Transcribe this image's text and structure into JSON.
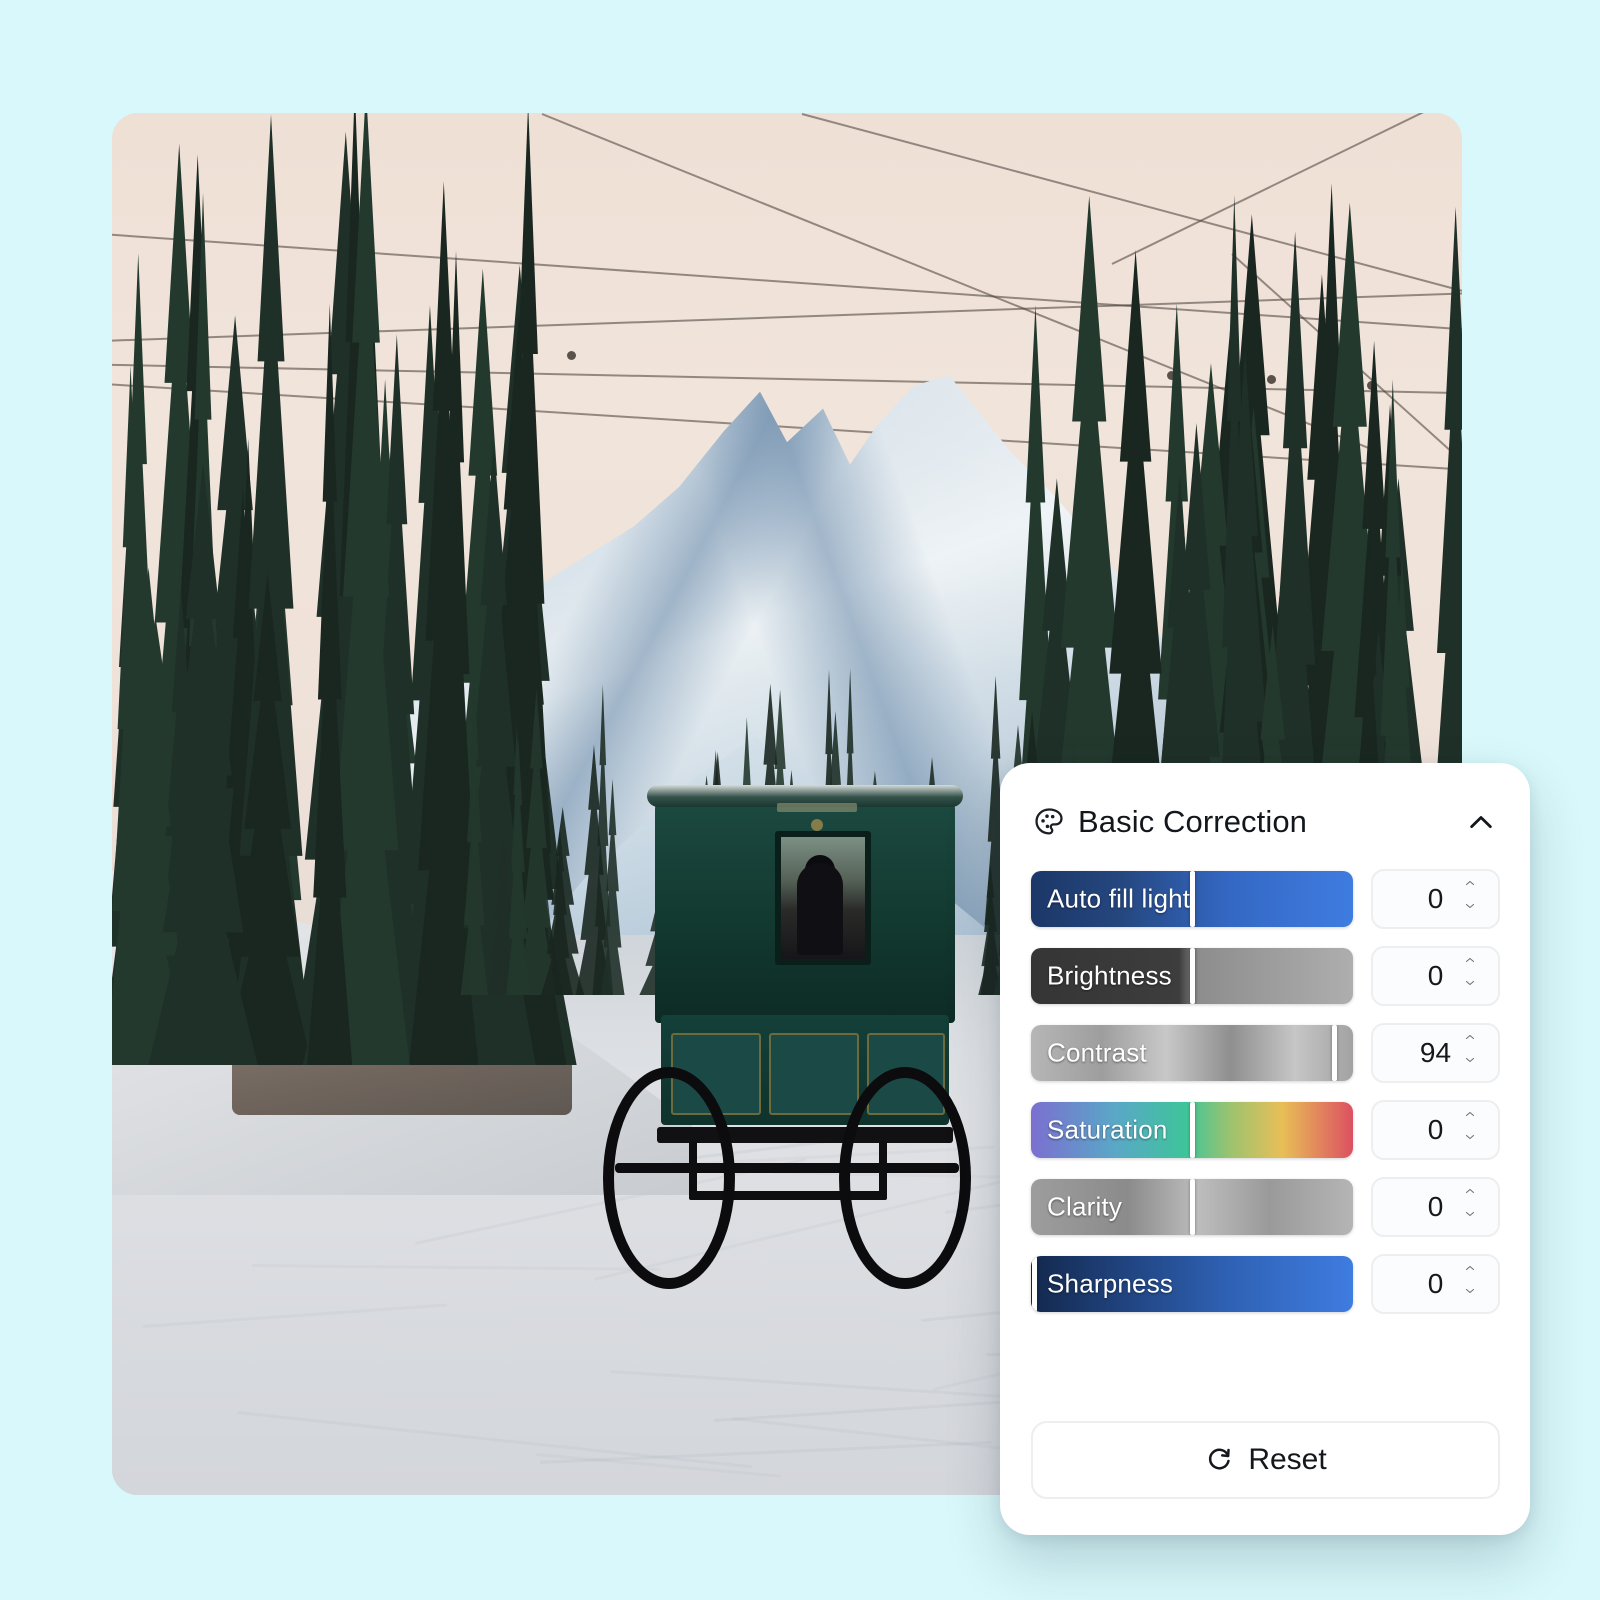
{
  "theme": {
    "background": "#d8f8fb",
    "panel_bg": "#ffffff",
    "accent_blue": "#3b76d8",
    "text": "#14181d"
  },
  "photo": {
    "alt_description": "Vintage dark green horse carriage driving down a snowy forest road toward a snow-covered mountain peak, overhead power lines in a pale sky"
  },
  "panel": {
    "title": "Basic Correction",
    "title_icon": "palette-icon",
    "collapse_icon": "chevron-up-icon",
    "sliders": [
      {
        "label": "Auto fill light",
        "value": "0",
        "handle_pct": 50,
        "track": "blue",
        "icon": "slider-track"
      },
      {
        "label": "Brightness",
        "value": "0",
        "handle_pct": 50,
        "track": "brightness",
        "icon": "slider-track"
      },
      {
        "label": "Contrast",
        "value": "94",
        "handle_pct": 94,
        "track": "contrast",
        "icon": "slider-track"
      },
      {
        "label": "Saturation",
        "value": "0",
        "handle_pct": 50,
        "track": "saturation",
        "icon": "slider-track"
      },
      {
        "label": "Clarity",
        "value": "0",
        "handle_pct": 50,
        "track": "clarity",
        "icon": "slider-track"
      },
      {
        "label": "Sharpness",
        "value": "0",
        "handle_pct": 1,
        "track": "sharpness",
        "icon": "slider-track"
      }
    ],
    "reset": {
      "label": "Reset",
      "icon": "refresh-icon"
    },
    "stepper_icons": {
      "up": "chevron-up-icon",
      "down": "chevron-down-icon"
    }
  }
}
